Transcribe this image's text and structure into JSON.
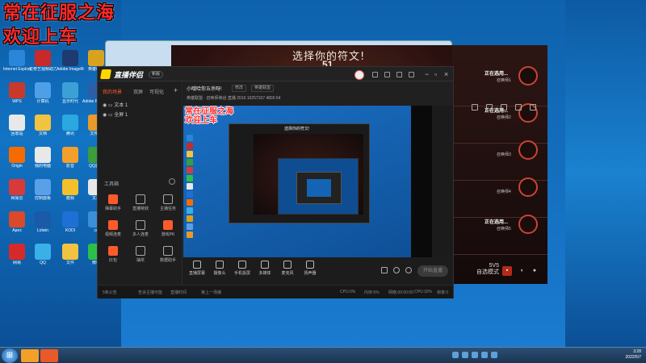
{
  "overlay": {
    "line1": "常在征服之海",
    "line2": "欢迎上车"
  },
  "desktop": {
    "icons": [
      {
        "label": "Internet Explorer",
        "color": "#2a86d8"
      },
      {
        "label": "爱奇艺视频助力",
        "color": "#c62a2a"
      },
      {
        "label": "Adobe ImageReady",
        "color": "#1e3a6e"
      },
      {
        "label": "英雄联盟",
        "color": "#d9a21e"
      },
      {
        "label": "WPS",
        "color": "#c9392b"
      },
      {
        "label": "计算机",
        "color": "#4da0e8"
      },
      {
        "label": "显示时代",
        "color": "#3ba0d6"
      },
      {
        "label": "Adobe Photoshop",
        "color": "#2a5fa8"
      },
      {
        "label": "回收站",
        "color": "#e8e8e8"
      },
      {
        "label": "文档",
        "color": "#f2c340"
      },
      {
        "label": "腾讯",
        "color": "#2aa8e0"
      },
      {
        "label": "文件夹",
        "color": "#e89a2a"
      },
      {
        "label": "Origin",
        "color": "#f56b00"
      },
      {
        "label": "我的电脑",
        "color": "#e8e8e8"
      },
      {
        "label": "影音",
        "color": "#f2a02a"
      },
      {
        "label": "QQ游戏",
        "color": "#3a9e3a"
      },
      {
        "label": "网易云",
        "color": "#d83a3a"
      },
      {
        "label": "控制面板",
        "color": "#5aa0e8"
      },
      {
        "label": "酷我",
        "color": "#f2c02a"
      },
      {
        "label": "文本",
        "color": "#e8e8e8"
      },
      {
        "label": "Apex",
        "color": "#d84a2a"
      },
      {
        "label": "Lolwin",
        "color": "#1a5aa8"
      },
      {
        "label": "KODI",
        "color": "#1e70d6"
      },
      {
        "label": "cc",
        "color": "#3a8fd8"
      },
      {
        "label": "网易",
        "color": "#d62a2a"
      },
      {
        "label": "QQ",
        "color": "#3ab0e8"
      },
      {
        "label": "文件",
        "color": "#f2c340"
      },
      {
        "label": "微信",
        "color": "#2ac04a"
      }
    ]
  },
  "game": {
    "title": "选择你的符文!",
    "number": "51",
    "slots": [
      {
        "name": "正在选用...",
        "role": "召唤师1"
      },
      {
        "name": "正在选用...",
        "role": "召唤师2"
      },
      {
        "name": "",
        "role": "召唤师3"
      },
      {
        "name": "",
        "role": "召唤师4"
      },
      {
        "name": "正在选用...",
        "role": "召唤师5"
      }
    ],
    "mode_line1": "5V5",
    "mode_line2": "自选模式"
  },
  "publisher": {
    "app_name": "直播伴侣",
    "badge": "新版",
    "left_tabs": [
      "我的场景",
      "双屏",
      "可视化"
    ],
    "scenes": [
      "文本 1",
      "全屏 1"
    ],
    "tools_header": "工具箱",
    "tools": [
      {
        "label": "弹幕助手",
        "hot": true
      },
      {
        "label": "直播特效",
        "hot": false
      },
      {
        "label": "主播任务",
        "hot": false
      },
      {
        "label": "视频连麦",
        "hot": true
      },
      {
        "label": "多人连麦",
        "hot": false
      },
      {
        "label": "游戏PK",
        "hot": true
      },
      {
        "label": "红包",
        "hot": true
      },
      {
        "label": "抽奖",
        "hot": false
      },
      {
        "label": "数据助手",
        "hot": false
      }
    ],
    "room_title": "小哦哈你五杀呀!",
    "room_chip1": "修改",
    "room_chip2": "英雄联盟",
    "stats": "英雄联盟 · 召唤师峡谷     直播 2016   10257167   4800   64",
    "bottom_buttons": [
      "直播屏幕",
      "摄像头",
      "手机投屏",
      "多媒体",
      "麦克风",
      "扬声器"
    ],
    "start_live": "开始直播",
    "status": [
      "5条公告",
      "告诉主播可能",
      "直播时间",
      "第上一场播",
      "CPU:0%",
      "内存:5%",
      "网络:00:00:00",
      "CPU:32%",
      "帧率:0"
    ]
  },
  "taskbar": {
    "time": "3:28",
    "date": "2022/5/7"
  }
}
